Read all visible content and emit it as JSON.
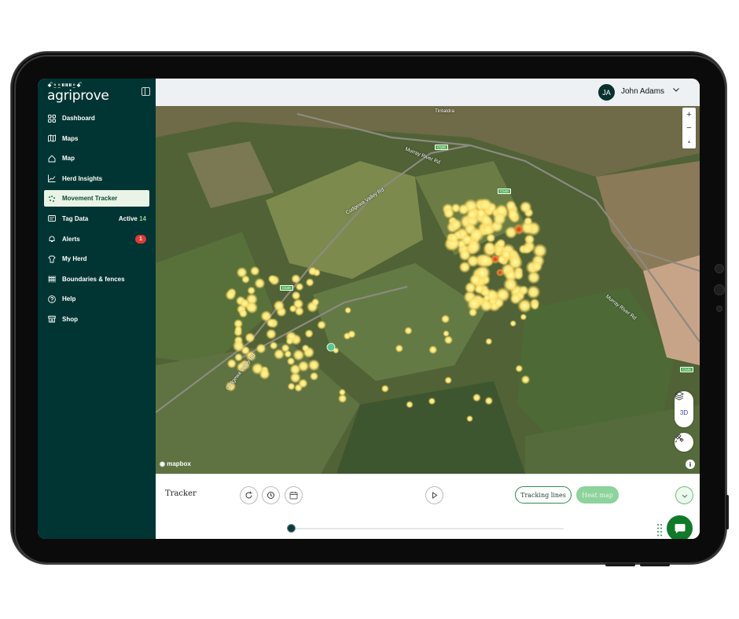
{
  "brand": {
    "name": "agriprove",
    "icon_row": "ꗃ⍛⍛⏸⏸⏸⍛ꗃ"
  },
  "sidebar": {
    "items": [
      {
        "label": "Dashboard",
        "icon": "dashboard-icon"
      },
      {
        "label": "Maps",
        "icon": "maps-icon"
      },
      {
        "label": "Map",
        "icon": "home-icon"
      },
      {
        "label": "Herd Insights",
        "icon": "chart-icon"
      },
      {
        "label": "Movement Tracker",
        "icon": "movement-icon",
        "active": true
      },
      {
        "label": "Tag Data",
        "icon": "tag-icon",
        "badge_text": "Active",
        "badge_count": "14"
      },
      {
        "label": "Alerts",
        "icon": "bell-icon",
        "badge_count": "1"
      },
      {
        "label": "My Herd",
        "icon": "herd-icon"
      },
      {
        "label": "Boundaries & fences",
        "icon": "fence-icon"
      },
      {
        "label": "Help",
        "icon": "help-icon"
      },
      {
        "label": "Shop",
        "icon": "shop-icon"
      }
    ]
  },
  "header": {
    "avatar_initials": "JA",
    "username": "John Adams"
  },
  "map": {
    "labels": {
      "town": "Tintaldra",
      "road1": "Murray River Rd",
      "road2": "Cudgewa Valley Rd",
      "road3": "Murray River Rd",
      "road4": "Cudgewa Valley Rd",
      "sign": "C546"
    },
    "zoom_in": "+",
    "zoom_out": "−",
    "compass": "▴",
    "toggle_3d": "3D",
    "attribution": "mapbox",
    "info": "i"
  },
  "tracker": {
    "title": "Tracker",
    "tracking_lines": "Tracking lines",
    "heat_map": "Heat map",
    "progress": 0
  },
  "colors": {
    "sidebar_bg": "#003533",
    "accent": "#0e7a2a",
    "heat_hot": "#e0281e",
    "heat_warm": "#f6c84a",
    "heat_cool": "#fff59a"
  }
}
